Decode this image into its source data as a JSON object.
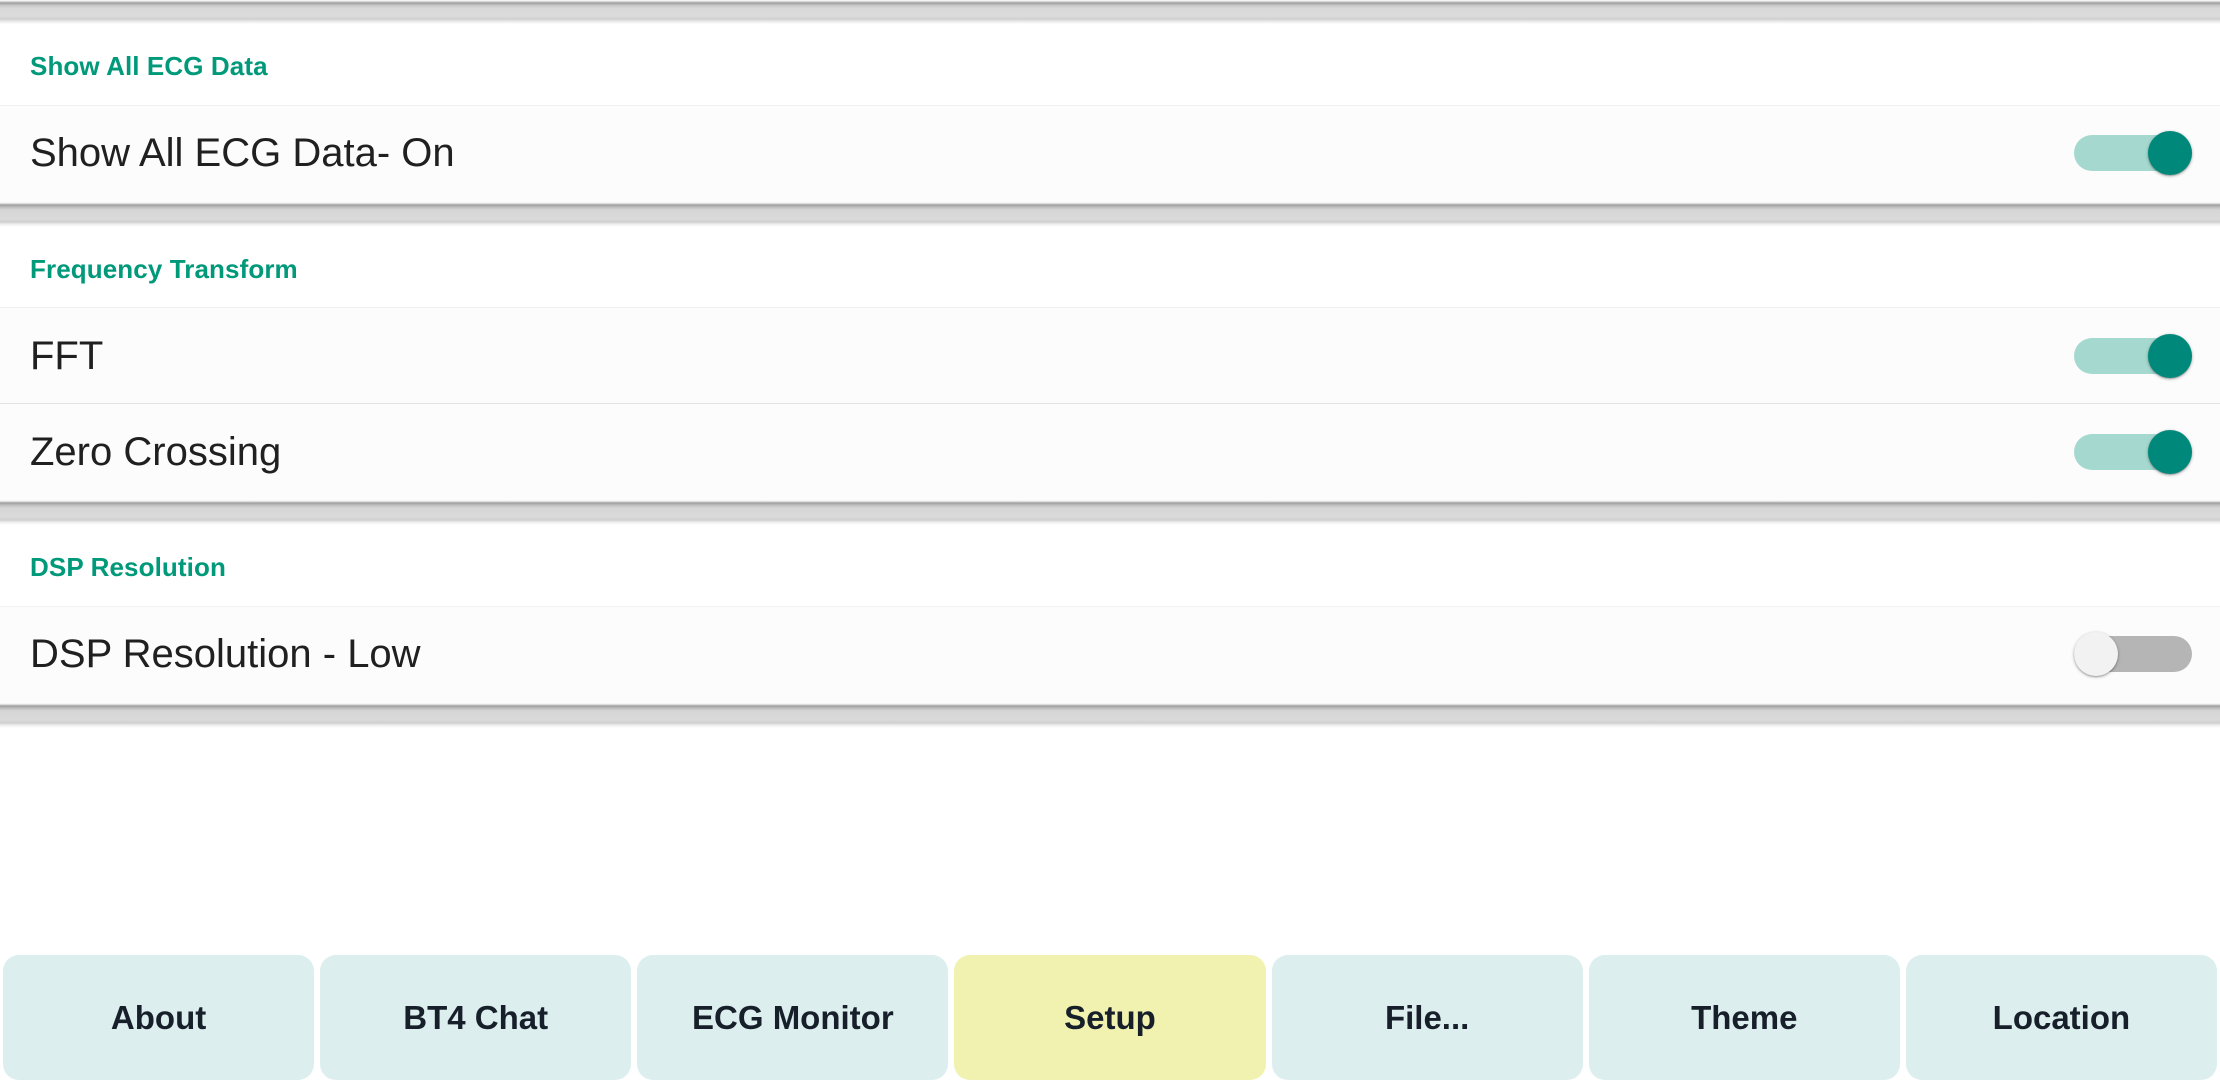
{
  "colors": {
    "section_header_teal": "#00997a",
    "toggle_on_track": "#a5d9cf",
    "toggle_on_thumb": "#00897b",
    "toggle_off_track": "#b5b5b5",
    "toggle_off_thumb": "#f2f2f2",
    "tab_background": "#dceeee",
    "tab_active_background": "#f1f2b0",
    "row_background": "#fcfcfc"
  },
  "sections": [
    {
      "header": "Show All ECG Data",
      "rows": [
        {
          "label": "Show All ECG Data- On",
          "toggle_state": "on",
          "toggle_name": "show-all-ecg-data-toggle"
        }
      ]
    },
    {
      "header": "Frequency Transform",
      "rows": [
        {
          "label": "FFT",
          "toggle_state": "on",
          "toggle_name": "fft-toggle"
        },
        {
          "label": "Zero Crossing",
          "toggle_state": "on",
          "toggle_name": "zero-crossing-toggle"
        }
      ]
    },
    {
      "header": "DSP Resolution",
      "rows": [
        {
          "label": "DSP Resolution - Low",
          "toggle_state": "off",
          "toggle_name": "dsp-resolution-toggle"
        }
      ]
    }
  ],
  "tabbar": {
    "tabs": [
      {
        "label": "About",
        "active": false,
        "name": "tab-about"
      },
      {
        "label": "BT4 Chat",
        "active": false,
        "name": "tab-bt4-chat"
      },
      {
        "label": "ECG Monitor",
        "active": false,
        "name": "tab-ecg-monitor"
      },
      {
        "label": "Setup",
        "active": true,
        "name": "tab-setup"
      },
      {
        "label": "File...",
        "active": false,
        "name": "tab-file"
      },
      {
        "label": "Theme",
        "active": false,
        "name": "tab-theme"
      },
      {
        "label": "Location",
        "active": false,
        "name": "tab-location"
      }
    ]
  }
}
